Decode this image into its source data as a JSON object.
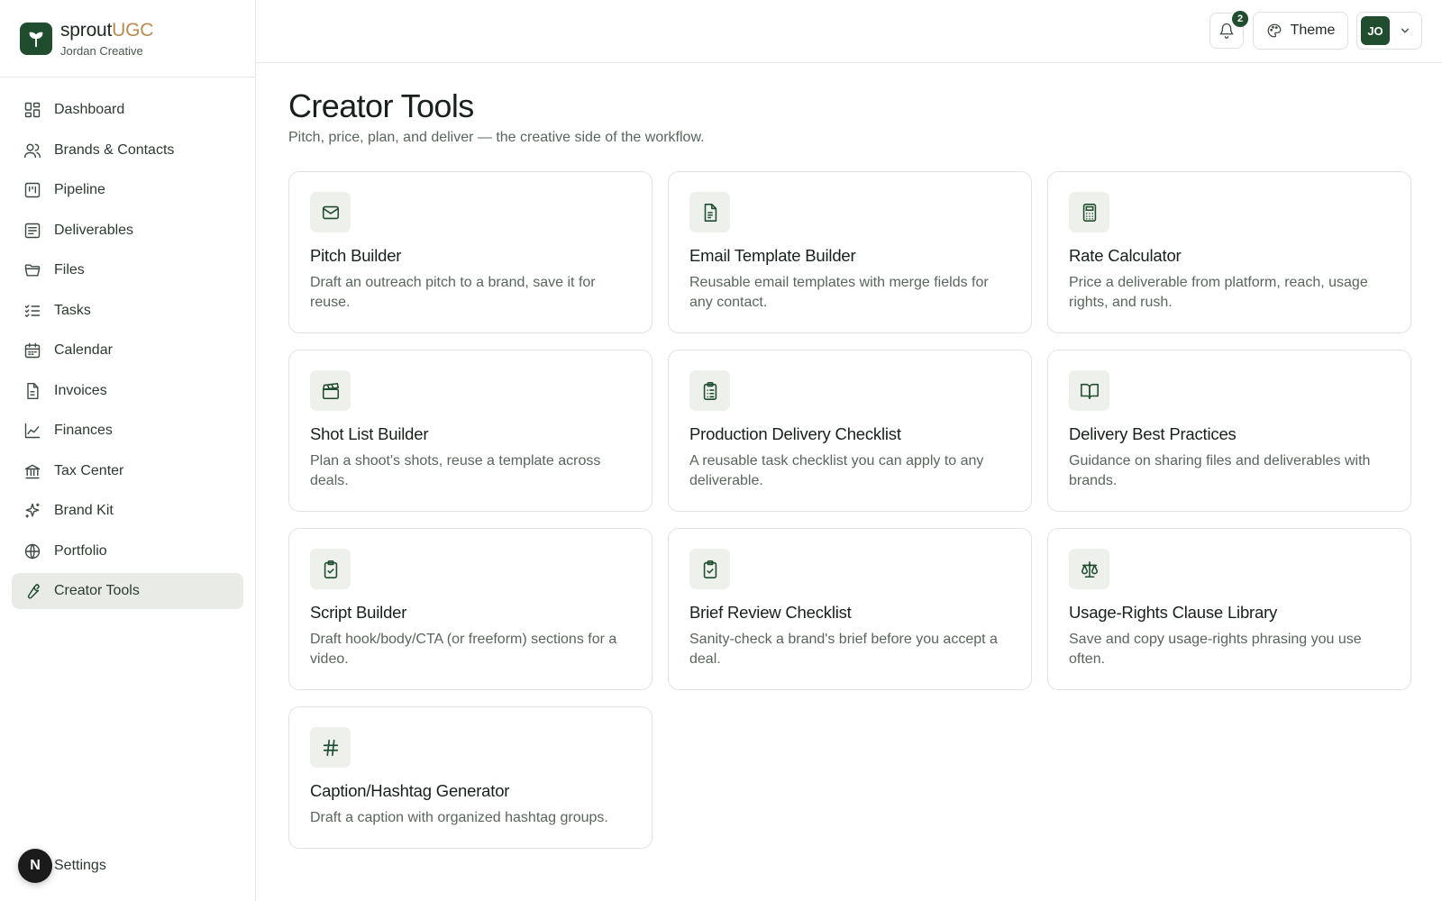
{
  "brand": {
    "name_part1": "sprout",
    "name_part2": "UGC",
    "workspace": "Jordan Creative"
  },
  "sidebar": {
    "items": [
      {
        "label": "Dashboard",
        "icon": "dashboard-icon"
      },
      {
        "label": "Brands & Contacts",
        "icon": "users-icon"
      },
      {
        "label": "Pipeline",
        "icon": "kanban-icon"
      },
      {
        "label": "Deliverables",
        "icon": "list-icon"
      },
      {
        "label": "Files",
        "icon": "folder-icon"
      },
      {
        "label": "Tasks",
        "icon": "checklist-icon"
      },
      {
        "label": "Calendar",
        "icon": "calendar-icon"
      },
      {
        "label": "Invoices",
        "icon": "file-icon"
      },
      {
        "label": "Finances",
        "icon": "chart-icon"
      },
      {
        "label": "Tax Center",
        "icon": "bank-icon"
      },
      {
        "label": "Brand Kit",
        "icon": "sparkles-icon"
      },
      {
        "label": "Portfolio",
        "icon": "globe-icon"
      },
      {
        "label": "Creator Tools",
        "icon": "wrench-icon",
        "active": true
      }
    ],
    "settings_label": "Settings",
    "settings_avatar": "N"
  },
  "topbar": {
    "notification_count": "2",
    "theme_label": "Theme",
    "user_initials": "JO"
  },
  "page": {
    "title": "Creator Tools",
    "subtitle": "Pitch, price, plan, and deliver — the creative side of the workflow."
  },
  "tools": [
    {
      "title": "Pitch Builder",
      "desc": "Draft an outreach pitch to a brand, save it for reuse.",
      "icon": "mail-icon"
    },
    {
      "title": "Email Template Builder",
      "desc": "Reusable email templates with merge fields for any contact.",
      "icon": "document-icon"
    },
    {
      "title": "Rate Calculator",
      "desc": "Price a deliverable from platform, reach, usage rights, and rush.",
      "icon": "calculator-icon"
    },
    {
      "title": "Shot List Builder",
      "desc": "Plan a shoot's shots, reuse a template across deals.",
      "icon": "clapperboard-icon"
    },
    {
      "title": "Production Delivery Checklist",
      "desc": "A reusable task checklist you can apply to any deliverable.",
      "icon": "clipboard-list-icon"
    },
    {
      "title": "Delivery Best Practices",
      "desc": "Guidance on sharing files and deliverables with brands.",
      "icon": "book-open-icon"
    },
    {
      "title": "Script Builder",
      "desc": "Draft hook/body/CTA (or freeform) sections for a video.",
      "icon": "clipboard-check-icon"
    },
    {
      "title": "Brief Review Checklist",
      "desc": "Sanity-check a brand's brief before you accept a deal.",
      "icon": "clipboard-check-icon"
    },
    {
      "title": "Usage-Rights Clause Library",
      "desc": "Save and copy usage-rights phrasing you use often.",
      "icon": "scale-icon"
    },
    {
      "title": "Caption/Hashtag Generator",
      "desc": "Draft a caption with organized hashtag groups.",
      "icon": "hash-icon"
    }
  ],
  "colors": {
    "accent": "#1f4d2e",
    "brand_secondary": "#b98b4e",
    "active_nav_bg": "#e8ebe6"
  }
}
